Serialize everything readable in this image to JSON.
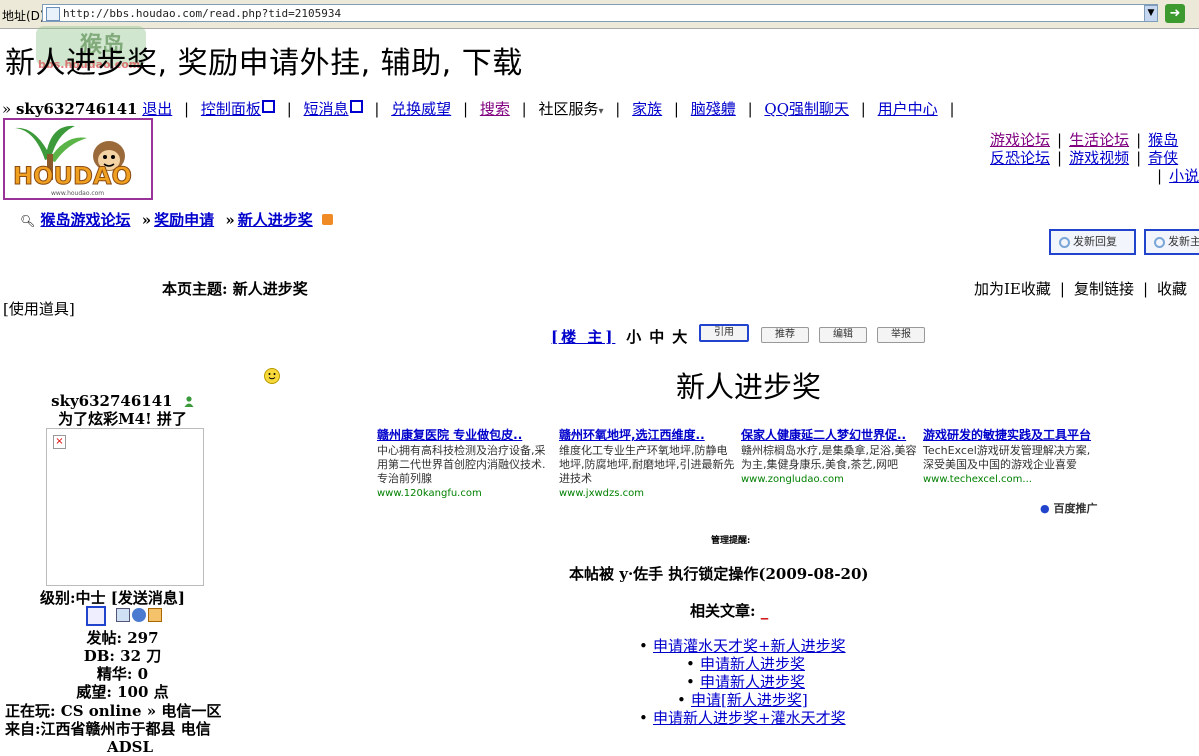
{
  "browser": {
    "address_label": "地址(D)",
    "url": "http://bbs.houdao.com/read.php?tid=2105934",
    "dropdown_symbol": "▼",
    "go_symbol": "➜"
  },
  "page": {
    "title": "新人进步奖, 奖励申请外挂, 辅助, 下载"
  },
  "watermark": {
    "text": "猴岛",
    "domain": "bbs.houdao.com"
  },
  "user_nav": {
    "prefix": "»",
    "username": "sky632746141",
    "items": [
      {
        "label": "退出"
      },
      {
        "label": "控制面板"
      },
      {
        "label": "短消息"
      },
      {
        "label": "兑换威望"
      },
      {
        "label": "搜索"
      },
      {
        "label": "社区服务"
      },
      {
        "label": "家族"
      },
      {
        "label": "脑殘軆"
      },
      {
        "label": "QQ强制聊天"
      },
      {
        "label": "用户中心"
      }
    ],
    "sep": "|",
    "dropdown_glyph": "▾"
  },
  "logo": {
    "text": "HOUDAO",
    "caption": "www.houdao.com"
  },
  "site_links": {
    "row1": [
      "游戏论坛",
      "生活论坛",
      "猴岛"
    ],
    "row2": [
      "反恐论坛",
      "游戏视频",
      "奇侠"
    ],
    "row3": [
      "小说"
    ]
  },
  "breadcrumb": {
    "items": [
      "猴岛游戏论坛",
      "奖励申请",
      "新人进步奖"
    ],
    "sep": "»"
  },
  "actions": {
    "new_reply": "发新回复",
    "new_topic": "发新主"
  },
  "topic": {
    "label": "本页主题:",
    "value": "新人进步奖",
    "tools": "[使用道具]"
  },
  "fav_links": [
    "加为IE收藏",
    "复制链接",
    "收藏"
  ],
  "post_controls": {
    "floor": "[楼 主]",
    "font_sizes": "小中大",
    "quote": "引用",
    "recommend": "推荐",
    "edit": "编辑",
    "report": "举报"
  },
  "profile": {
    "username": "sky632746141",
    "signature": "为了炫彩M4! 拼了",
    "level_label": "级别:",
    "level_value": "中士",
    "send_message": "[发送消息]",
    "posts": "发帖: 297",
    "db": "DB: 32 刀",
    "essence": "精华: 0",
    "prestige": "威望: 100 点",
    "playing": "正在玩: CS online » 电信一区",
    "from": "来自:江西省赣州市于都县 电信",
    "from_cont": "ADSL"
  },
  "post": {
    "title": "新人进步奖",
    "admin_note": "管理提醒:",
    "lock_note": "本帖被 y·佐手 执行锁定操作(2009-08-20)",
    "related_label": "相关文章:",
    "related_underscore": "_"
  },
  "ads": [
    {
      "title": "赣州康复医院 专业做包皮..",
      "desc": "中心拥有高科技检测及治疗设备,采用第二代世界首创腔内消融仪技术.专治前列腺",
      "url": "www.120kangfu.com"
    },
    {
      "title": "赣州环氧地坪,选江西维度..",
      "desc": "维度化工专业生产环氧地坪,防静电地坪,防腐地坪,耐磨地坪,引进最新先进技术",
      "url": "www.jxwdzs.com"
    },
    {
      "title": "保家人健康延二人梦幻世界促..",
      "desc": "赣州棕榈岛水疗,是集桑拿,足浴,美容为主,集健身康乐,美食,茶艺,网吧",
      "url": "www.zongludao.com"
    },
    {
      "title": "游戏研发的敏捷实践及工具平台",
      "desc": "TechExcel游戏研发管理解决方案,深受美国及中国的游戏企业喜爱",
      "url": "www.techexcel.com..."
    }
  ],
  "baidu": "百度推广",
  "related_articles": [
    {
      "label": "申请灌水天才奖+新人进步奖",
      "level": 0
    },
    {
      "label": "申请新人进步奖",
      "level": 1
    },
    {
      "label": "申请新人进步奖",
      "level": 1
    },
    {
      "label": "申请[新人进步奖]",
      "level": 1
    },
    {
      "label": "申请新人进步奖+灌水天才奖",
      "level": 0
    }
  ]
}
